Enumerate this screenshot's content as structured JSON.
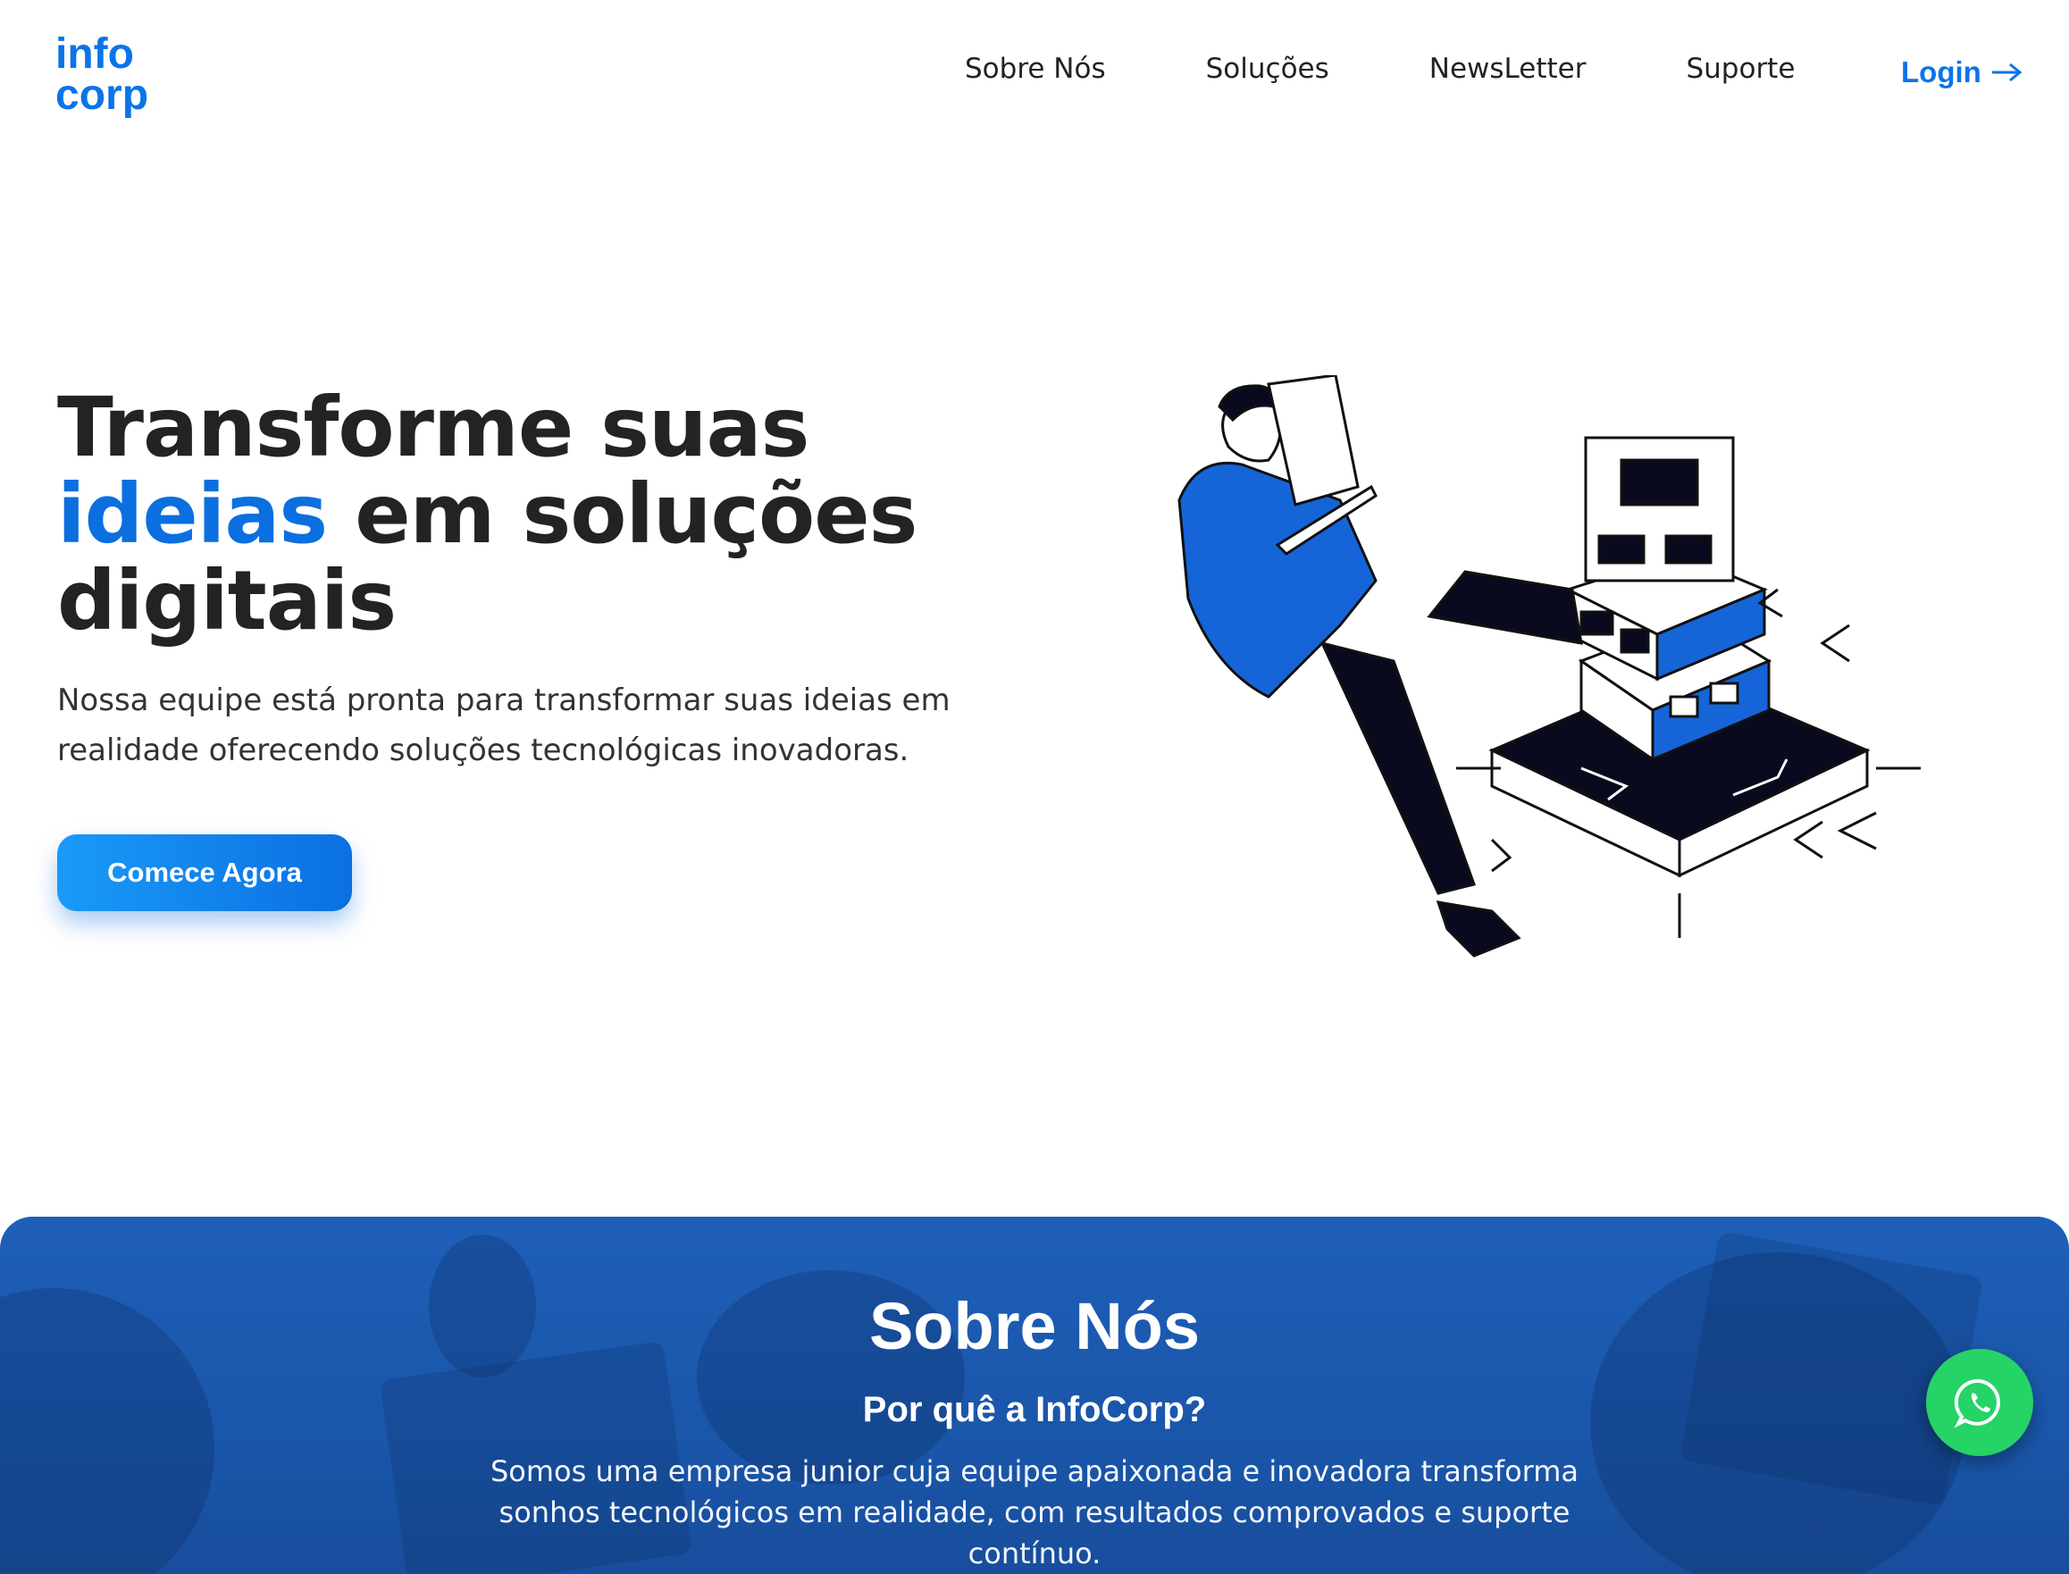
{
  "brand": {
    "logo_line1": "info",
    "logo_line2": "corp",
    "accent_color": "#0b6fe0"
  },
  "nav": {
    "items": [
      {
        "label": "Sobre Nós"
      },
      {
        "label": "Soluções"
      },
      {
        "label": "NewsLetter"
      },
      {
        "label": "Suporte"
      }
    ],
    "login_label": "Login"
  },
  "hero": {
    "title_line1": "Transforme suas",
    "title_accent": "ideias",
    "title_line2_rest": " em soluções",
    "title_line3": "digitais",
    "subtitle": "Nossa equipe está pronta para transformar suas ideias em realidade oferecendo soluções tecnológicas inovadoras.",
    "cta_label": "Comece Agora",
    "illustration_icon": "person-with-laptop-and-blocks-illustration"
  },
  "about": {
    "title": "Sobre Nós",
    "subtitle": "Por quê a InfoCorp?",
    "text": "Somos uma empresa junior cuja equipe apaixonada e inovadora transforma sonhos tecnológicos em realidade, com resultados comprovados e suporte contínuo.",
    "background_color": "#1e5fb8"
  },
  "floating": {
    "whatsapp_icon": "whatsapp-icon",
    "whatsapp_color": "#25d366"
  }
}
